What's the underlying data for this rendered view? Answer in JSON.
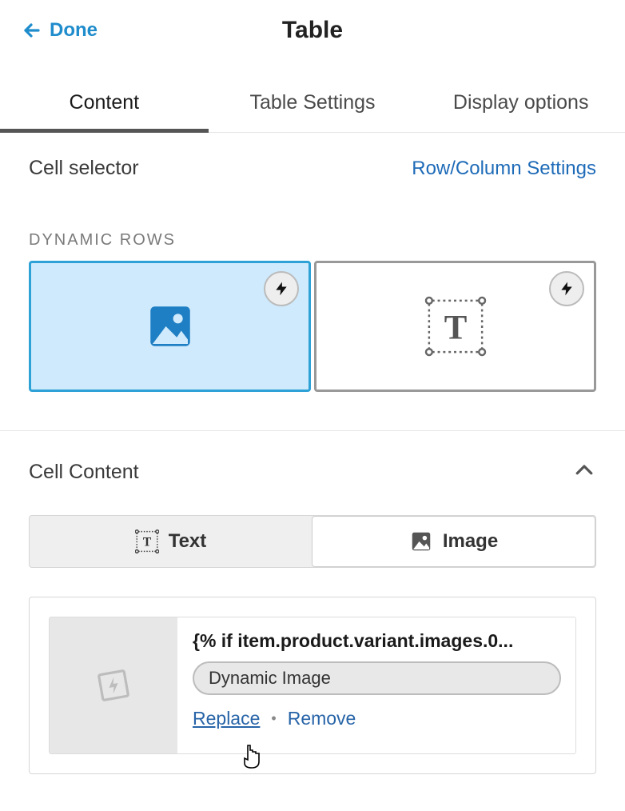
{
  "header": {
    "back_label": "Done",
    "title": "Table"
  },
  "tabs": {
    "content": "Content",
    "table_settings": "Table Settings",
    "display_options": "Display options"
  },
  "cell_selector": {
    "label": "Cell selector",
    "row_col_link": "Row/Column Settings"
  },
  "dynamic_rows": {
    "heading": "DYNAMIC ROWS"
  },
  "cell_content": {
    "title": "Cell Content",
    "toggle_text": "Text",
    "toggle_image": "Image"
  },
  "asset": {
    "code": "{% if item.product.variant.images.0...",
    "pill": "Dynamic Image",
    "replace": "Replace",
    "remove": "Remove"
  }
}
